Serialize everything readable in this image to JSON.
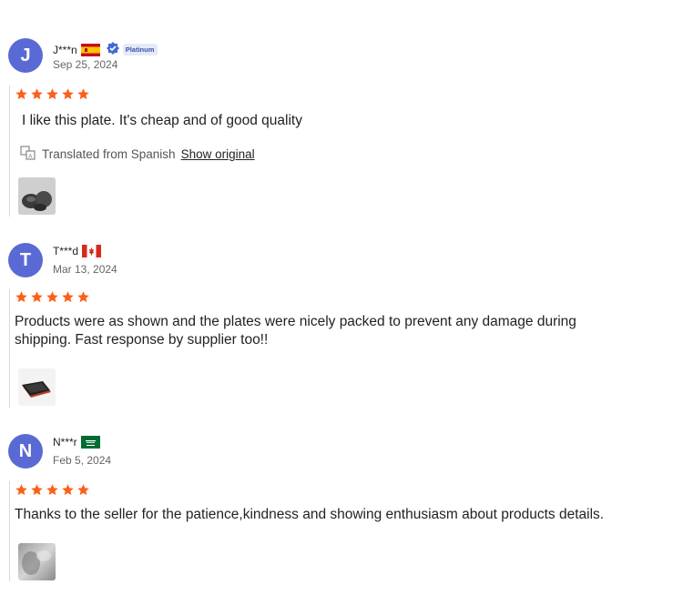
{
  "reviews": [
    {
      "avatar_letter": "J",
      "name": "J***n",
      "country": "Spain",
      "badge": "Platinum",
      "date": "Sep 25, 2024",
      "text": "I like this plate. It's cheap and of good quality",
      "translated_label": "Translated from Spanish",
      "show_original": "Show original"
    },
    {
      "avatar_letter": "T",
      "name": "T***d",
      "country": "Canada",
      "date": "Mar 13, 2024",
      "text": "Products were as shown and the plates were nicely packed to prevent any damage during shipping. Fast response by supplier too!!"
    },
    {
      "avatar_letter": "N",
      "name": "N***r",
      "country": "Saudi Arabia",
      "date": "Feb 5, 2024",
      "text": "Thanks to the seller for the patience,kindness and showing enthusiasm about products details."
    }
  ],
  "colors": {
    "avatar": "#5a6ad4",
    "star": "#fd5f1a",
    "badge_bg": "#e4eaf7",
    "badge_text": "#3a4fa8"
  },
  "icons": [
    "verified-badge-icon",
    "star-icon",
    "translate-icon"
  ]
}
